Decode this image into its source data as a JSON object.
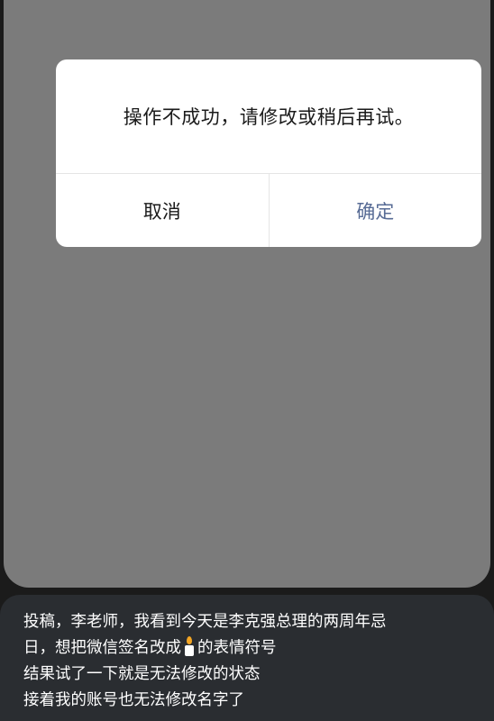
{
  "dialog": {
    "message": "操作不成功，请修改或稍后再试。",
    "cancel_label": "取消",
    "confirm_label": "确定"
  },
  "caption": {
    "line1": "投稿，李老师，我看到今天是李克强总理的两周年忌",
    "line2_before": "日，想把微信签名改成",
    "line2_icon": "candle-icon",
    "line2_after": "的表情符号",
    "line3": "结果试了一下就是无法修改的状态",
    "line4": "接着我的账号也无法修改名字了"
  },
  "colors": {
    "overlay": "#7b7b7b",
    "dialog_bg": "#ffffff",
    "confirm_text": "#576b95",
    "caption_bg": "#2a2d31"
  }
}
